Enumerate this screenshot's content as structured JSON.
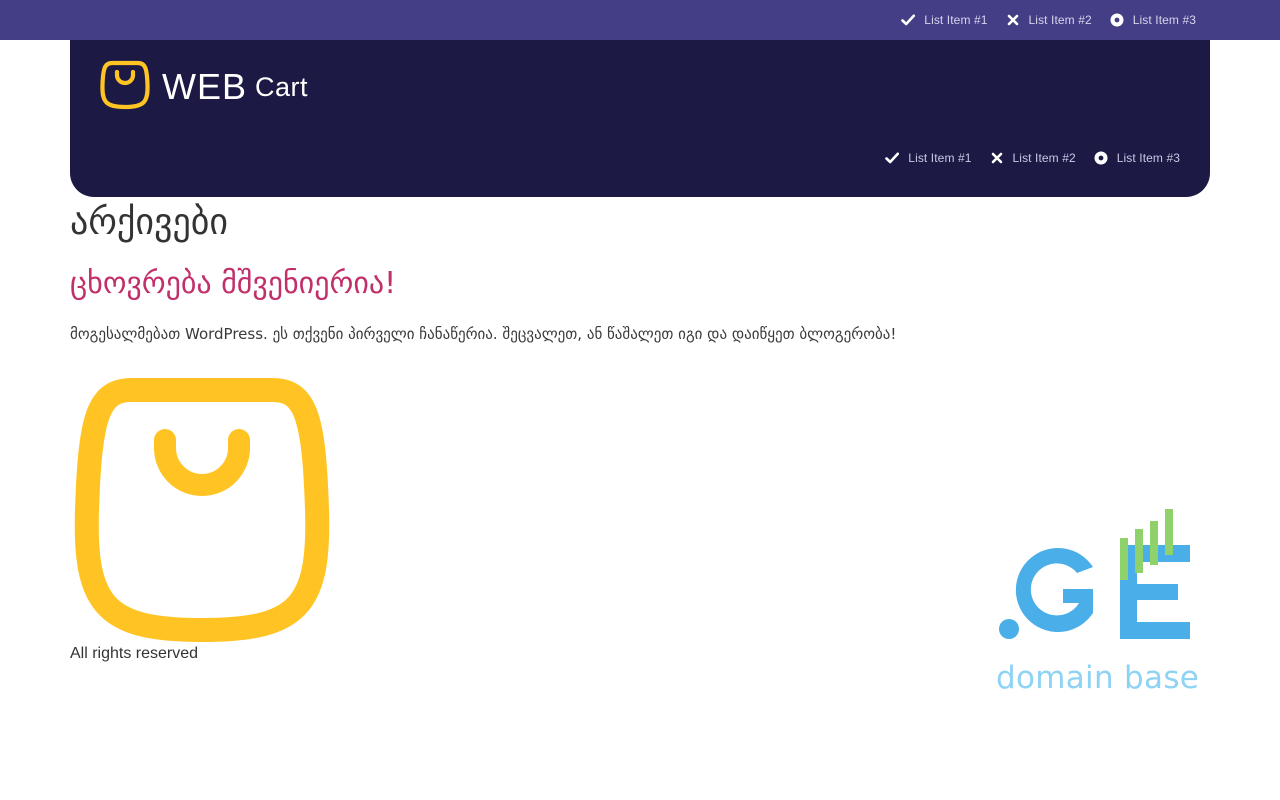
{
  "topbar": {
    "items": [
      {
        "label": "List Item #1",
        "icon": "check-icon"
      },
      {
        "label": "List Item #2",
        "icon": "close-icon"
      },
      {
        "label": "List Item #3",
        "icon": "dot-circle-icon"
      }
    ]
  },
  "header": {
    "logo": {
      "word": "WEB",
      "sub": "Cart",
      "icon": "shopping-bag-icon"
    },
    "items": [
      {
        "label": "List Item #1",
        "icon": "check-icon"
      },
      {
        "label": "List Item #2",
        "icon": "close-icon"
      },
      {
        "label": "List Item #3",
        "icon": "dot-circle-icon"
      }
    ]
  },
  "main": {
    "page_title": "არქივები",
    "post": {
      "title": "ცხოვრება მშვენიერია!",
      "excerpt": "მოგესალმებათ WordPress. ეს თქვენი პირველი ჩანაწერია. შეცვალეთ, ან წაშალეთ იგი და დაიწყეთ ბლოგერობა!"
    }
  },
  "footer": {
    "copyright": "All rights reserved",
    "partner": {
      "text": "domain base",
      "icon": "ge-domain-logo"
    }
  },
  "colors": {
    "topbar": "#433e85",
    "header": "#1c1a44",
    "accent": "#c1306b",
    "bag_yellow": "#ffc423",
    "ge_blue": "#4aaee8",
    "ge_green": "#8fd16a"
  }
}
